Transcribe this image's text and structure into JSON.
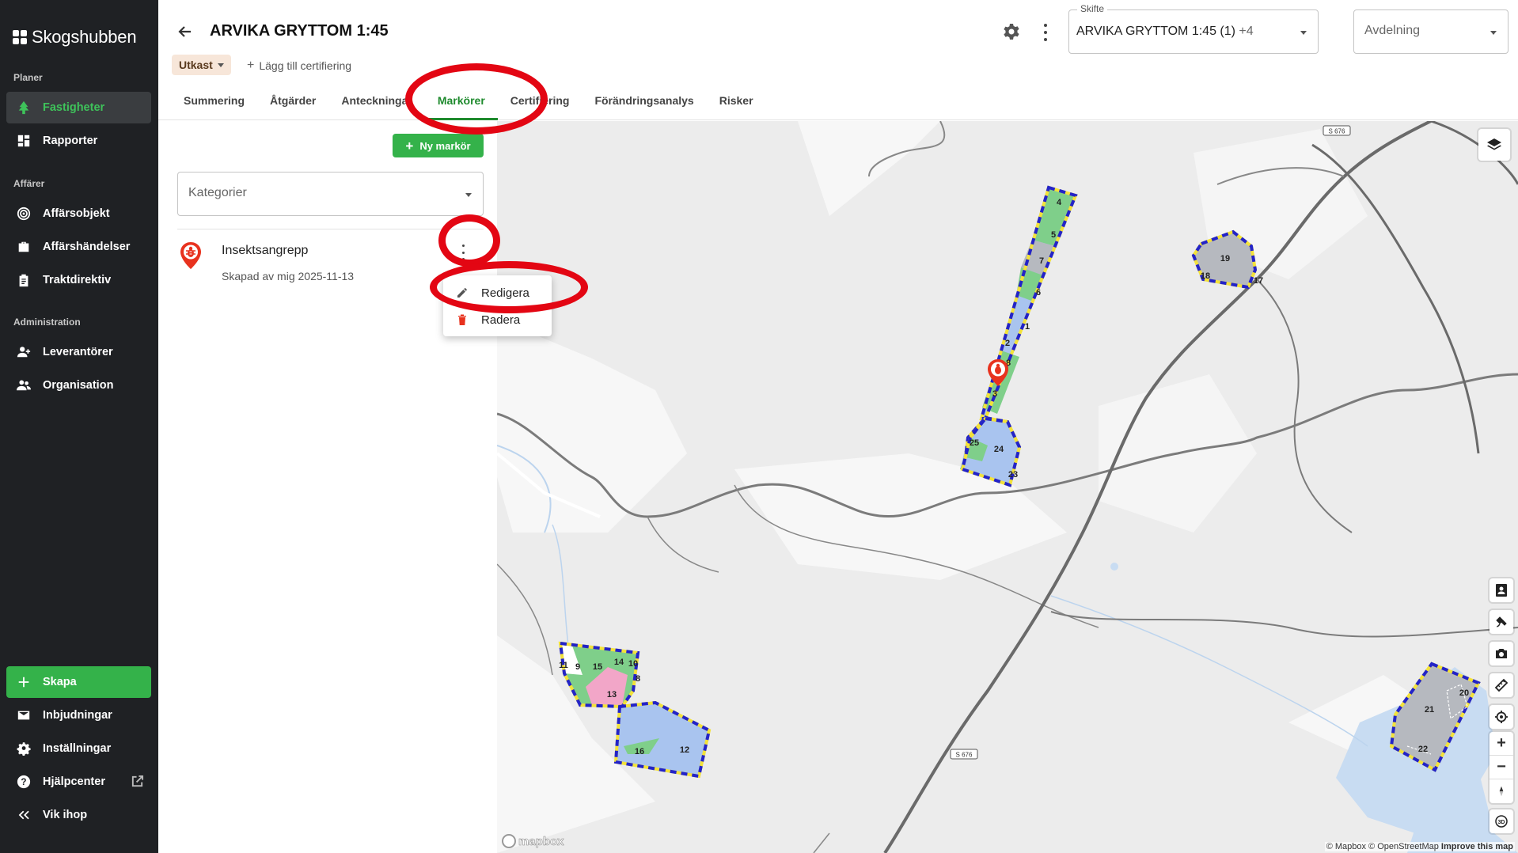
{
  "sidebar": {
    "brand": "Skogshubben",
    "sections": {
      "planer": "Planer",
      "affarer": "Affärer",
      "administration": "Administration"
    },
    "items": [
      {
        "label": "Fastigheter",
        "icon": "tree-icon"
      },
      {
        "label": "Rapporter",
        "icon": "dashboard-icon"
      },
      {
        "label": "Affärsobjekt",
        "icon": "target-icon"
      },
      {
        "label": "Affärshändelser",
        "icon": "briefcase-icon"
      },
      {
        "label": "Traktdirektiv",
        "icon": "clipboard-icon"
      },
      {
        "label": "Leverantörer",
        "icon": "users-plus-icon"
      },
      {
        "label": "Organisation",
        "icon": "people-icon"
      }
    ],
    "bottom": [
      {
        "label": "Skapa",
        "icon": "plus-icon"
      },
      {
        "label": "Inbjudningar",
        "icon": "mail-icon"
      },
      {
        "label": "Inställningar",
        "icon": "gear-icon"
      },
      {
        "label": "Hjälpcenter",
        "icon": "help-icon"
      },
      {
        "label": "Vik ihop",
        "icon": "collapse-icon"
      }
    ]
  },
  "header": {
    "title": "ARVIKA GRYTTOM 1:45",
    "status": "Utkast",
    "add_cert": "Lägg till certifiering",
    "tabs": [
      "Summering",
      "Åtgärder",
      "Anteckningar",
      "Markörer",
      "Certifiering",
      "Förändringsanalys",
      "Risker"
    ],
    "active_tab": "Markörer",
    "skifte": {
      "label": "Skifte",
      "value": "ARVIKA GRYTTOM 1:45 (1)",
      "extra": "+4"
    },
    "avdelning": {
      "placeholder": "Avdelning"
    }
  },
  "panel": {
    "new_marker": "Ny markör",
    "categories_placeholder": "Kategorier",
    "marker": {
      "title": "Insektsangrepp",
      "subtitle": "Skapad av mig 2025-11-13"
    },
    "menu": [
      {
        "label": "Redigera",
        "icon": "pencil-icon"
      },
      {
        "label": "Radera",
        "icon": "trash-icon"
      }
    ]
  },
  "map": {
    "road_label": "S 676",
    "stand_numbers": [
      "1",
      "2",
      "3",
      "4",
      "5",
      "6",
      "7",
      "8",
      "9",
      "10",
      "11",
      "12",
      "13",
      "14",
      "15",
      "16",
      "17",
      "18",
      "19",
      "20",
      "21",
      "22",
      "23",
      "24",
      "25"
    ],
    "attribution": "© Mapbox © OpenStreetMap",
    "improve": "Improve this map",
    "logo": "mapbox",
    "colors": {
      "green": "#7fcf8a",
      "blue": "#a9c4ef",
      "grey": "#b6b9bf",
      "pink": "#f2a6c8",
      "boundary_dash_a": "#2323c8",
      "boundary_dash_b": "#f3e23a"
    }
  },
  "annotation_color": "#e30613"
}
